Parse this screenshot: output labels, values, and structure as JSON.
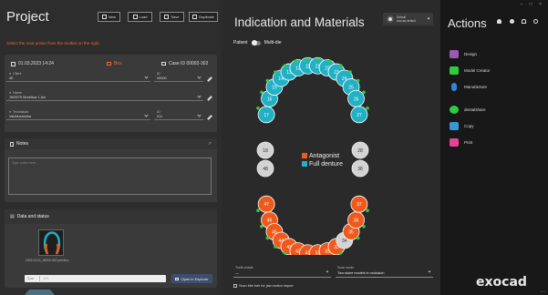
{
  "project": {
    "title": "Project",
    "buttons": {
      "new": "New",
      "load": "Load",
      "save": "Save",
      "duplicate": "Duplicate"
    },
    "hint": "Select the next action from the toolbar on the right.",
    "date": "01.03.2023 14:24",
    "box": "Box",
    "case_id": "Case ID 00002-302",
    "client": {
      "label": "Client",
      "value": "4E",
      "id_label": "ID",
      "id_value": "00000"
    },
    "name": {
      "label": "Name",
      "value": "JW2079 Workflow 1 Am"
    },
    "technician": {
      "label": "Technician",
      "value": "VahidusAmika",
      "id_label": "ID",
      "id_value": "011"
    },
    "notes": {
      "header": "Notes",
      "placeholder": "Type notes here..."
    },
    "data_status": {
      "header": "Data and status",
      "thumb_caption": "2023-03-01_00002-302 preview...",
      "scan_label": "Scan",
      "scan_placeholder": "USB",
      "explorer_button": "Open in Explorer"
    }
  },
  "indication": {
    "title": "Indication and Materials",
    "profile": {
      "line1": "Default",
      "line2": "exocad default"
    },
    "toggle_left": "Patient",
    "toggle_right": "Multi-die",
    "legend": [
      {
        "label": "Antagonist",
        "color": "#ef5a1c"
      },
      {
        "label": "Full denture",
        "color": "#22b0c4"
      }
    ],
    "tooth_shade": {
      "label": "Tooth shade",
      "value": "—"
    },
    "scan_mode": {
      "label": "Scan mode",
      "value": "Two stone models in occlusion"
    },
    "checkbox_label": "Scan bite fork for jaw motion import"
  },
  "teeth": {
    "upper": [
      {
        "n": "18",
        "c": "#d3d3d3",
        "state": "white"
      },
      {
        "n": "17",
        "c": "#22b0c4"
      },
      {
        "n": "16",
        "c": "#22b0c4"
      },
      {
        "n": "15",
        "c": "#22b0c4"
      },
      {
        "n": "14",
        "c": "#22b0c4"
      },
      {
        "n": "13",
        "c": "#22b0c4"
      },
      {
        "n": "12",
        "c": "#22b0c4"
      },
      {
        "n": "11",
        "c": "#22b0c4"
      },
      {
        "n": "21",
        "c": "#22b0c4"
      },
      {
        "n": "22",
        "c": "#22b0c4"
      },
      {
        "n": "23",
        "c": "#22b0c4"
      },
      {
        "n": "24",
        "c": "#22b0c4"
      },
      {
        "n": "25",
        "c": "#22b0c4"
      },
      {
        "n": "26",
        "c": "#22b0c4"
      },
      {
        "n": "27",
        "c": "#22b0c4"
      },
      {
        "n": "28",
        "c": "#d3d3d3",
        "state": "white"
      }
    ],
    "lower": [
      {
        "n": "48",
        "c": "#d3d3d3",
        "state": "white"
      },
      {
        "n": "47",
        "c": "#ef5a1c"
      },
      {
        "n": "46",
        "c": "#ef5a1c"
      },
      {
        "n": "45",
        "c": "#ef5a1c"
      },
      {
        "n": "44",
        "c": "#ef5a1c"
      },
      {
        "n": "43",
        "c": "#ef5a1c"
      },
      {
        "n": "42",
        "c": "#ef5a1c"
      },
      {
        "n": "41",
        "c": "#ef5a1c"
      },
      {
        "n": "31",
        "c": "#ef5a1c"
      },
      {
        "n": "32",
        "c": "#ef5a1c"
      },
      {
        "n": "33",
        "c": "#ef5a1c"
      },
      {
        "n": "34",
        "c": "#d3d3d3",
        "state": "white"
      },
      {
        "n": "35",
        "c": "#ef5a1c"
      },
      {
        "n": "36",
        "c": "#ef5a1c"
      },
      {
        "n": "37",
        "c": "#ef5a1c"
      },
      {
        "n": "38",
        "c": "#d3d3d3",
        "state": "white"
      }
    ]
  },
  "actions": {
    "title": "Actions",
    "items": [
      {
        "label": "Design",
        "icon": "design-icon",
        "color": "#9b59b6"
      },
      {
        "label": "Model Creator",
        "icon": "model-creator-icon",
        "color": "#2ecc40"
      },
      {
        "label": "Manufacture",
        "icon": "manufacture-icon",
        "color": "#2e86de"
      },
      {
        "label": "dentalshare",
        "icon": "dentalshare-icon",
        "color": "#2ecc40"
      },
      {
        "label": "Copy",
        "icon": "copy-icon",
        "color": "#3498db"
      },
      {
        "label": "Print",
        "icon": "print-icon",
        "color": "#e84393"
      }
    ],
    "brand": "exocad"
  }
}
